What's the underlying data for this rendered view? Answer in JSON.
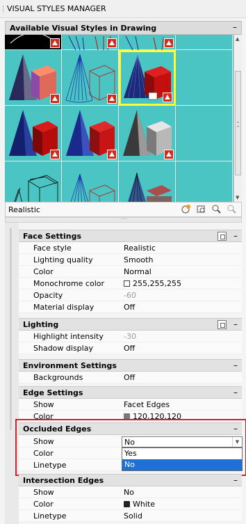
{
  "window": {
    "title": "VISUAL STYLES MANAGER"
  },
  "gallery_panel": {
    "title": "Available Visual Styles in Drawing",
    "minimize_label": "–"
  },
  "gallery": {
    "selected_style": "Realistic"
  },
  "status": {
    "current_style": "Realistic",
    "tools": [
      "create-style-icon",
      "apply-to-viewport-icon",
      "export-tool-palette-icon",
      "delete-style-icon"
    ]
  },
  "handle_dots": "·····",
  "sections": {
    "face": {
      "title": "Face Settings",
      "min": "–",
      "rows": [
        {
          "k": "Face style",
          "v": "Realistic"
        },
        {
          "k": "Lighting quality",
          "v": "Smooth"
        },
        {
          "k": "Color",
          "v": "Normal"
        },
        {
          "k": "Monochrome color",
          "v": "255,255,255"
        },
        {
          "k": "Opacity",
          "v": "-60"
        },
        {
          "k": "Material display",
          "v": "Off"
        }
      ]
    },
    "lighting": {
      "title": "Lighting",
      "min": "–",
      "rows": [
        {
          "k": "Highlight intensity",
          "v": "-30"
        },
        {
          "k": "Shadow display",
          "v": "Off"
        }
      ]
    },
    "environment": {
      "title": "Environment Settings",
      "min": "–",
      "rows": [
        {
          "k": "Backgrounds",
          "v": "Off"
        }
      ]
    },
    "edge": {
      "title": "Edge Settings",
      "min": "–",
      "rows": [
        {
          "k": "Show",
          "v": "Facet Edges"
        },
        {
          "k": "Color",
          "v": "120,120,120"
        }
      ]
    },
    "occluded": {
      "title": "Occluded Edges",
      "min": "–",
      "rows": [
        {
          "k": "Show",
          "v": "No"
        },
        {
          "k": "Color",
          "v": ""
        },
        {
          "k": "Linetype",
          "v": ""
        }
      ],
      "dropdown": {
        "value": "No",
        "arrow": "▼",
        "options": [
          "Yes",
          "No"
        ],
        "highlighted": "No"
      }
    },
    "intersection": {
      "title": "Intersection Edges",
      "min": "–",
      "rows": [
        {
          "k": "Show",
          "v": "No"
        },
        {
          "k": "Color",
          "v": "White"
        },
        {
          "k": "Linetype",
          "v": "Solid"
        }
      ]
    }
  },
  "colors": {
    "accent": "#1e6fd6",
    "highlight_box": "#d11f2b",
    "gallery_bg": "#4bc4c4",
    "selection": "#ffff33"
  }
}
